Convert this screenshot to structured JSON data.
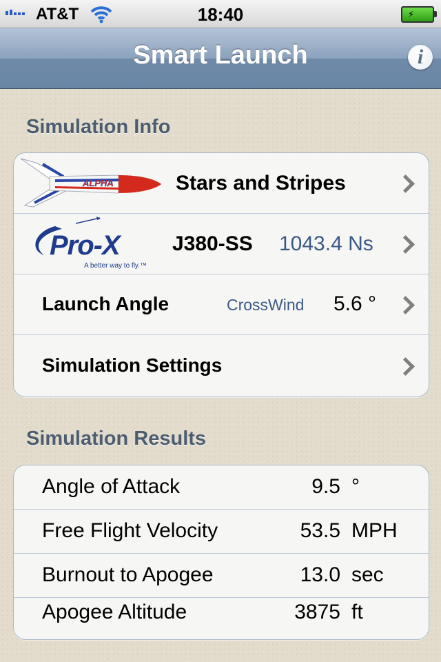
{
  "status_bar": {
    "carrier": "AT&T",
    "time": "18:40"
  },
  "nav": {
    "title": "Smart Launch",
    "info_label": "i"
  },
  "simulation_info": {
    "header": "Simulation Info",
    "rocket_name": "Stars and Stripes",
    "rocket_image_text": "ALPHA",
    "motor_logo": "Pro-X",
    "motor_tagline": "A better way to fly.™",
    "motor_name": "J380-SS",
    "motor_impulse": "1043.4 Ns",
    "launch_angle_label": "Launch Angle",
    "crosswind_label": "CrossWind",
    "launch_angle_value": "5.6 °",
    "settings_label": "Simulation Settings"
  },
  "simulation_results": {
    "header": "Simulation Results",
    "rows": [
      {
        "label": "Angle of Attack",
        "value": "9.5",
        "unit": "°"
      },
      {
        "label": "Free Flight Velocity",
        "value": "53.5",
        "unit": "MPH"
      },
      {
        "label": "Burnout to Apogee",
        "value": "13.0",
        "unit": "sec"
      },
      {
        "label": "Apogee Altitude",
        "value": "3875",
        "unit": "ft"
      }
    ]
  },
  "colors": {
    "nav_bar": "#7f97b3",
    "section_header": "#4d5d70",
    "detail_text": "#3a5a86",
    "rocket_red": "#d42a1e",
    "prox_blue": "#1e3b8c"
  }
}
